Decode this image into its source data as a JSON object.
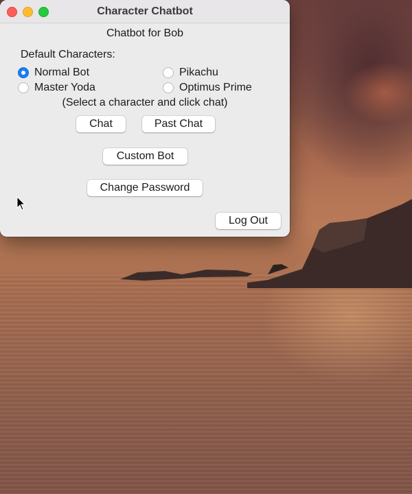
{
  "window": {
    "title": "Character Chatbot"
  },
  "main": {
    "heading": "Chatbot for Bob",
    "section_label": "Default Characters:",
    "characters": [
      {
        "label": "Normal Bot",
        "selected": true
      },
      {
        "label": "Pikachu",
        "selected": false
      },
      {
        "label": "Master Yoda",
        "selected": false
      },
      {
        "label": "Optimus Prime",
        "selected": false
      }
    ],
    "hint": "(Select a character and click chat)"
  },
  "buttons": {
    "chat": "Chat",
    "past_chat": "Past Chat",
    "custom_bot": "Custom Bot",
    "change_password": "Change Password",
    "log_out": "Log Out"
  },
  "icons": {
    "close": "close-icon",
    "minimize": "minimize-icon",
    "maximize": "maximize-icon",
    "cursor": "mouse-pointer-icon"
  },
  "colors": {
    "window_bg": "#ecebec",
    "radio_selected": "#1a7cf5",
    "close": "#fe5f57",
    "minimize": "#febc2e",
    "maximize": "#28c840"
  }
}
